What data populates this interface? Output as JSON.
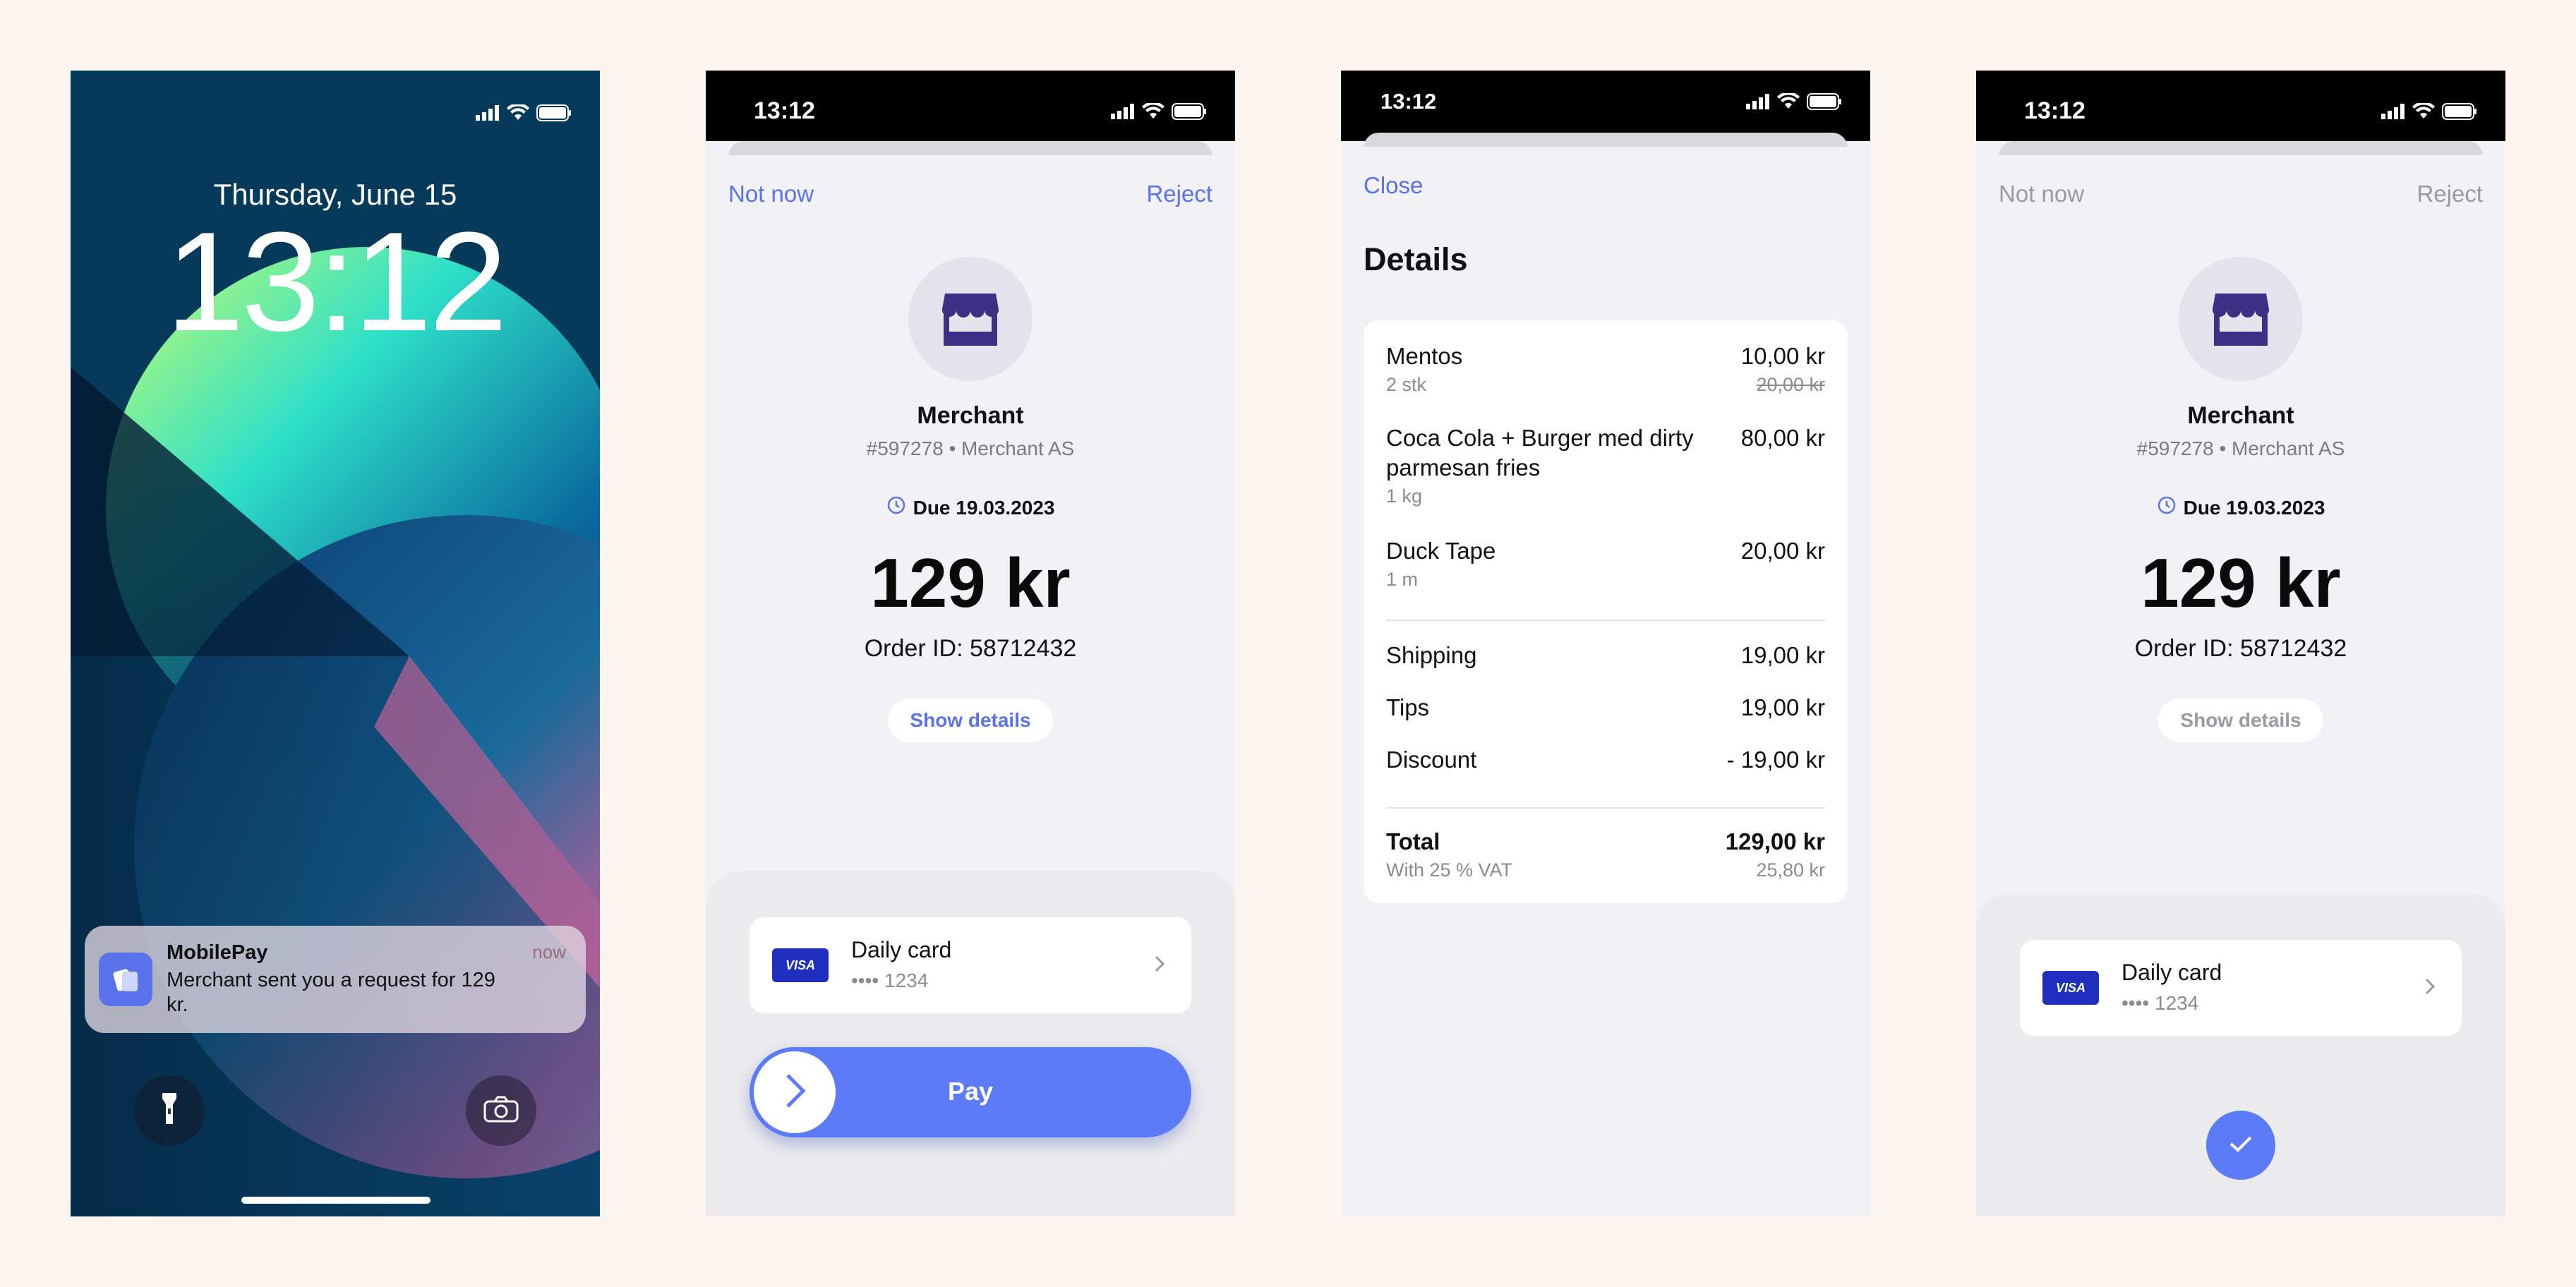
{
  "lock": {
    "date": "Thursday, June 15",
    "time": "13:12",
    "notification": {
      "app": "MobilePay",
      "when": "now",
      "message": "Merchant sent you a request for 129 kr."
    },
    "icons": [
      "signal-icon",
      "wifi-icon",
      "battery-icon",
      "flashlight-icon",
      "camera-icon"
    ]
  },
  "request": {
    "status_time": "13:12",
    "not_now": "Not now",
    "reject": "Reject",
    "merchant_name": "Merchant",
    "merchant_sub": "#597278 • Merchant AS",
    "due": "Due 19.03.2023",
    "amount": "129 kr",
    "order_id": "Order ID: 58712432",
    "show_details": "Show details",
    "card": {
      "brand": "VISA",
      "name": "Daily card",
      "number": "•••• 1234"
    },
    "pay": "Pay"
  },
  "details": {
    "status_time": "13:12",
    "close": "Close",
    "title": "Details",
    "items": [
      {
        "name": "Mentos",
        "qty": "2 stk",
        "price": "10,00 kr",
        "original": "20,00 kr"
      },
      {
        "name": "Coca Cola + Burger med dirty parmesan fries",
        "qty": "1 kg",
        "price": "80,00 kr"
      },
      {
        "name": "Duck Tape",
        "qty": "1 m",
        "price": "20,00 kr"
      }
    ],
    "fees": [
      {
        "label": "Shipping",
        "value": "19,00 kr"
      },
      {
        "label": "Tips",
        "value": "19,00 kr"
      },
      {
        "label": "Discount",
        "value": "- 19,00 kr"
      }
    ],
    "total": {
      "label": "Total",
      "value": "129,00 kr",
      "vat_label": "With 25 % VAT",
      "vat_value": "25,80 kr"
    }
  },
  "paid": {
    "status_time": "13:12",
    "not_now": "Not now",
    "reject": "Reject",
    "merchant_name": "Merchant",
    "merchant_sub": "#597278 • Merchant AS",
    "due": "Due 19.03.2023",
    "amount": "129 kr",
    "order_id": "Order ID: 58712432",
    "show_details": "Show details",
    "card": {
      "brand": "VISA",
      "name": "Daily card",
      "number": "•••• 1234"
    }
  },
  "colors": {
    "accent": "#5b73ea",
    "button": "#5b7bf9",
    "background": "#fdf5ef",
    "sheet": "#f1f1f6",
    "visa": "#1f2fbf"
  }
}
